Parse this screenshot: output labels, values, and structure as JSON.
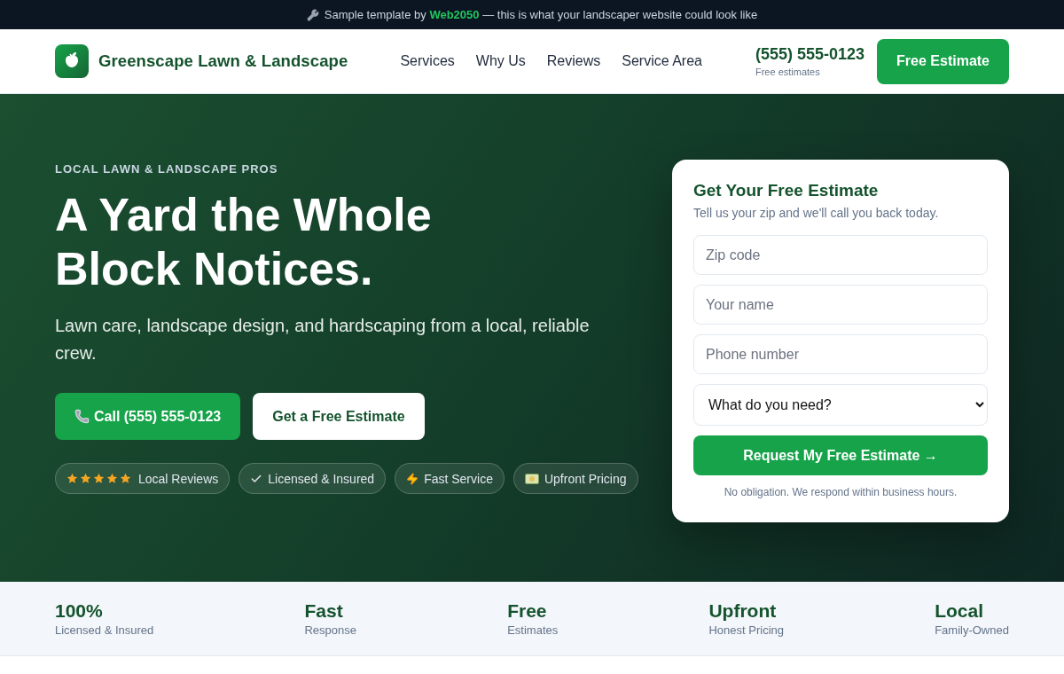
{
  "top_banner": {
    "text_before": "Sample template by",
    "link": "Web2050",
    "text_after": "— this is what your landscaper website could look like"
  },
  "header": {
    "brand": "Greenscape Lawn & Landscape",
    "nav": [
      "Services",
      "Why Us",
      "Reviews",
      "Service Area"
    ],
    "phone": "(555) 555-0123",
    "phone_note": "Free estimates",
    "cta": "Free Estimate"
  },
  "hero": {
    "kicker": "LOCAL LAWN & LANDSCAPE PROS",
    "title": "A Yard the Whole Block Notices.",
    "subtitle": "Lawn care, landscape design, and hardscaping from a local, reliable crew.",
    "buttons": [
      {
        "label": "Call (555) 555-0123",
        "kind": "primary"
      },
      {
        "label": "Get a Free Estimate",
        "kind": "secondary"
      }
    ],
    "badges": [
      {
        "kind": "rating",
        "stars": 5,
        "label": "Local Reviews"
      },
      {
        "kind": "feature",
        "label": "Licensed & Insured"
      },
      {
        "kind": "feature",
        "label": "Fast Service"
      },
      {
        "kind": "feature",
        "label": "Upfront Pricing"
      }
    ]
  },
  "estimate_form": {
    "title": "Get Your Free Estimate",
    "subtitle": "Tell us your zip and we'll call you back today.",
    "fields": [
      {
        "placeholder": "Zip code"
      },
      {
        "placeholder": "Your name"
      },
      {
        "placeholder": "Phone number"
      }
    ],
    "select": {
      "value": "What do you need?"
    },
    "submit": "Request My Free Estimate →",
    "note": "No obligation. We respond within business hours."
  },
  "stats": [
    {
      "value": "100%",
      "label": "Licensed & Insured"
    },
    {
      "value": "Fast",
      "label": "Response"
    },
    {
      "value": "Free",
      "label": "Estimates"
    },
    {
      "value": "Upfront",
      "label": "Honest Pricing"
    },
    {
      "value": "Local",
      "label": "Family-Owned"
    }
  ]
}
